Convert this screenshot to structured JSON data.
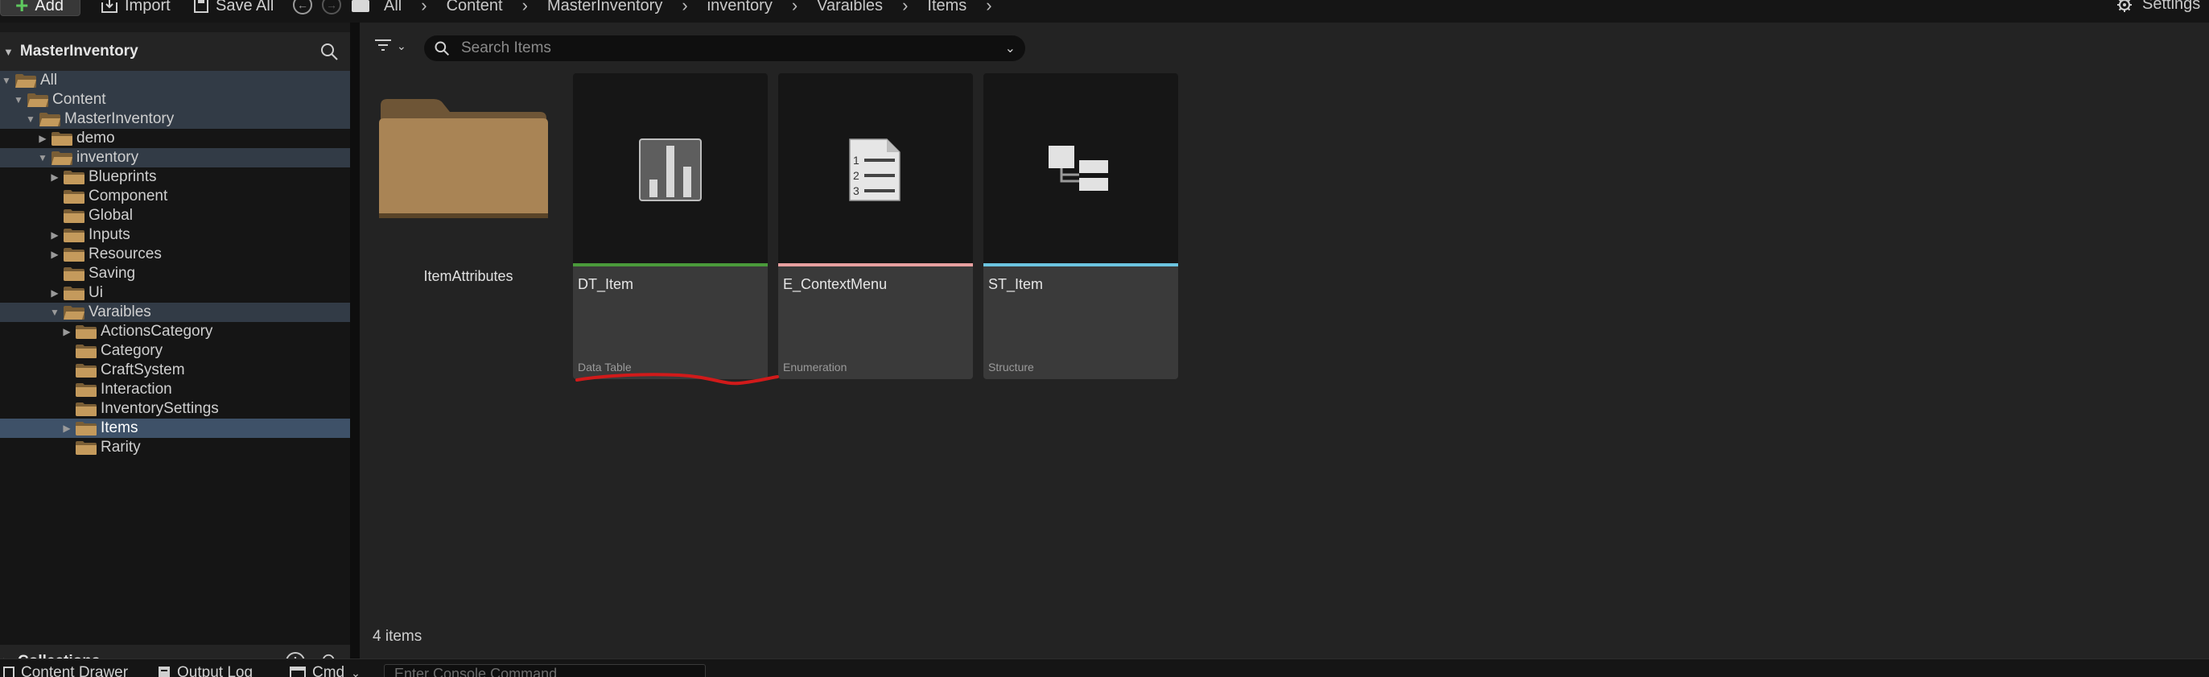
{
  "toolbar": {
    "add_label": "Add",
    "import_label": "Import",
    "saveall_label": "Save All",
    "breadcrumb": [
      "All",
      "Content",
      "MasterInventory",
      "inventory",
      "Varaibles",
      "Items"
    ],
    "settings_label": "Settings"
  },
  "sidebar": {
    "title": "MasterInventory",
    "tree": [
      {
        "label": "All",
        "depth": 0,
        "arrow": "down",
        "open": true,
        "style": "sel"
      },
      {
        "label": "Content",
        "depth": 1,
        "arrow": "down",
        "open": true,
        "style": "sel"
      },
      {
        "label": "MasterInventory",
        "depth": 2,
        "arrow": "down",
        "open": true,
        "style": "sel"
      },
      {
        "label": "demo",
        "depth": 3,
        "arrow": "right",
        "open": false,
        "style": ""
      },
      {
        "label": "inventory",
        "depth": 3,
        "arrow": "down",
        "open": true,
        "style": "sel"
      },
      {
        "label": "Blueprints",
        "depth": 4,
        "arrow": "right",
        "open": false,
        "style": ""
      },
      {
        "label": "Component",
        "depth": 4,
        "arrow": "",
        "open": false,
        "style": ""
      },
      {
        "label": "Global",
        "depth": 4,
        "arrow": "",
        "open": false,
        "style": ""
      },
      {
        "label": "Inputs",
        "depth": 4,
        "arrow": "right",
        "open": false,
        "style": ""
      },
      {
        "label": "Resources",
        "depth": 4,
        "arrow": "right",
        "open": false,
        "style": ""
      },
      {
        "label": "Saving",
        "depth": 4,
        "arrow": "",
        "open": false,
        "style": ""
      },
      {
        "label": "Ui",
        "depth": 4,
        "arrow": "right",
        "open": false,
        "style": ""
      },
      {
        "label": "Varaibles",
        "depth": 4,
        "arrow": "down",
        "open": true,
        "style": "sel"
      },
      {
        "label": "ActionsCategory",
        "depth": 5,
        "arrow": "right",
        "open": false,
        "style": ""
      },
      {
        "label": "Category",
        "depth": 5,
        "arrow": "",
        "open": false,
        "style": ""
      },
      {
        "label": "CraftSystem",
        "depth": 5,
        "arrow": "",
        "open": false,
        "style": ""
      },
      {
        "label": "Interaction",
        "depth": 5,
        "arrow": "",
        "open": false,
        "style": ""
      },
      {
        "label": "InventorySettings",
        "depth": 5,
        "arrow": "",
        "open": false,
        "style": ""
      },
      {
        "label": "Items",
        "depth": 5,
        "arrow": "right",
        "open": false,
        "style": "active"
      },
      {
        "label": "Rarity",
        "depth": 5,
        "arrow": "",
        "open": false,
        "style": ""
      }
    ],
    "collections_label": "Collections"
  },
  "main": {
    "search_placeholder": "Search Items",
    "folder": {
      "name": "ItemAttributes"
    },
    "assets": [
      {
        "name": "DT_Item",
        "type": "Data Table",
        "bar_color": "#4a9a3a",
        "icon": "data-table-icon"
      },
      {
        "name": "E_ContextMenu",
        "type": "Enumeration",
        "bar_color": "#e8a0a0",
        "icon": "enumeration-icon"
      },
      {
        "name": "ST_Item",
        "type": "Structure",
        "bar_color": "#6cc4e0",
        "icon": "structure-icon"
      }
    ],
    "items_count": "4 items",
    "annotation_color": "#d11a1a"
  },
  "bottom": {
    "tabs": [
      "Content Drawer",
      "Output Log",
      "Cmd"
    ],
    "console_placeholder": "Enter Console Command"
  }
}
